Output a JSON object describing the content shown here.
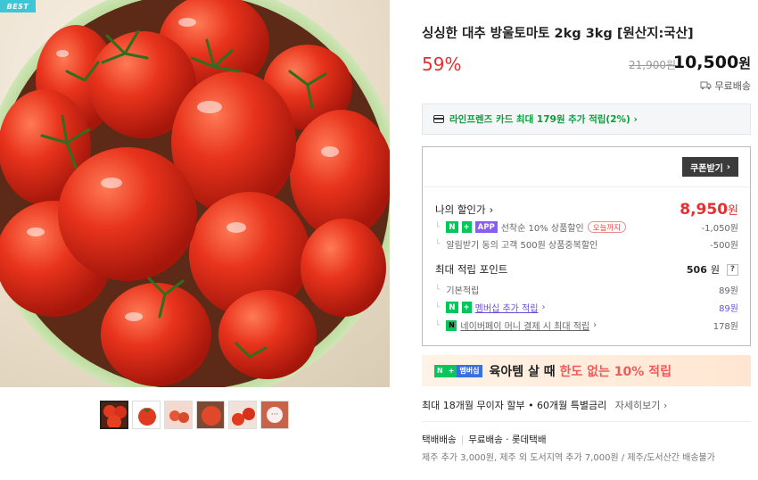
{
  "badge": "BEST",
  "product": {
    "title": "싱싱한 대추 방울토마토 2kg 3kg [원산지:국산]",
    "discount_rate": "59%",
    "original_price": "21,900원",
    "sale_price": "10,500",
    "price_unit": "원",
    "shipping": "무료배송"
  },
  "card_promo": "라인프렌즈 카드 최대 179원 추가 적립(2%) ›",
  "benefit": {
    "coupon_button": "쿠폰받기",
    "my_discount_label": "나의 할인가",
    "my_discount_price": "8,950",
    "my_discount_unit": "원",
    "discount_items": [
      {
        "tags": [
          "N",
          "+",
          "APP"
        ],
        "label": "선착순 10% 상품할인",
        "pill": "오늘까지",
        "value": "-1,050원"
      },
      {
        "label": "알림받기 동의 고객 500원 상품중복할인",
        "value": "-500원"
      }
    ],
    "points_label": "최대 적립 포인트",
    "points_value": "506",
    "points_unit": "원",
    "help": "?",
    "point_items": [
      {
        "label": "기본적립",
        "value": "89원"
      },
      {
        "label": "멤버십 추가 적립",
        "value": "89원"
      },
      {
        "label": "네이버페이 머니 결제 시 최대 적립",
        "value": "178원"
      }
    ]
  },
  "promo_banner": {
    "badge_n": "N",
    "badge_plus": "+",
    "badge_membership": "멤버십",
    "text_prefix": "육아템 살 때",
    "text_highlight": "한도 없는 10% 적립"
  },
  "installment": {
    "text": "최대 18개월 무이자 할부 • 60개월 특별금리",
    "more": "자세히보기 ›"
  },
  "delivery": {
    "method": "택배배송",
    "fee": "무료배송",
    "carrier": "롯데택배",
    "note": "제주 추가 3,000원, 제주 외 도서지역 추가 7,000원 / 제주/도서산간 배송불가"
  },
  "thumbnail_more": "···",
  "colors": {
    "accent_red": "#e62f2f",
    "naver_green": "#03c75a",
    "membership_purple": "#6b4fd8"
  }
}
